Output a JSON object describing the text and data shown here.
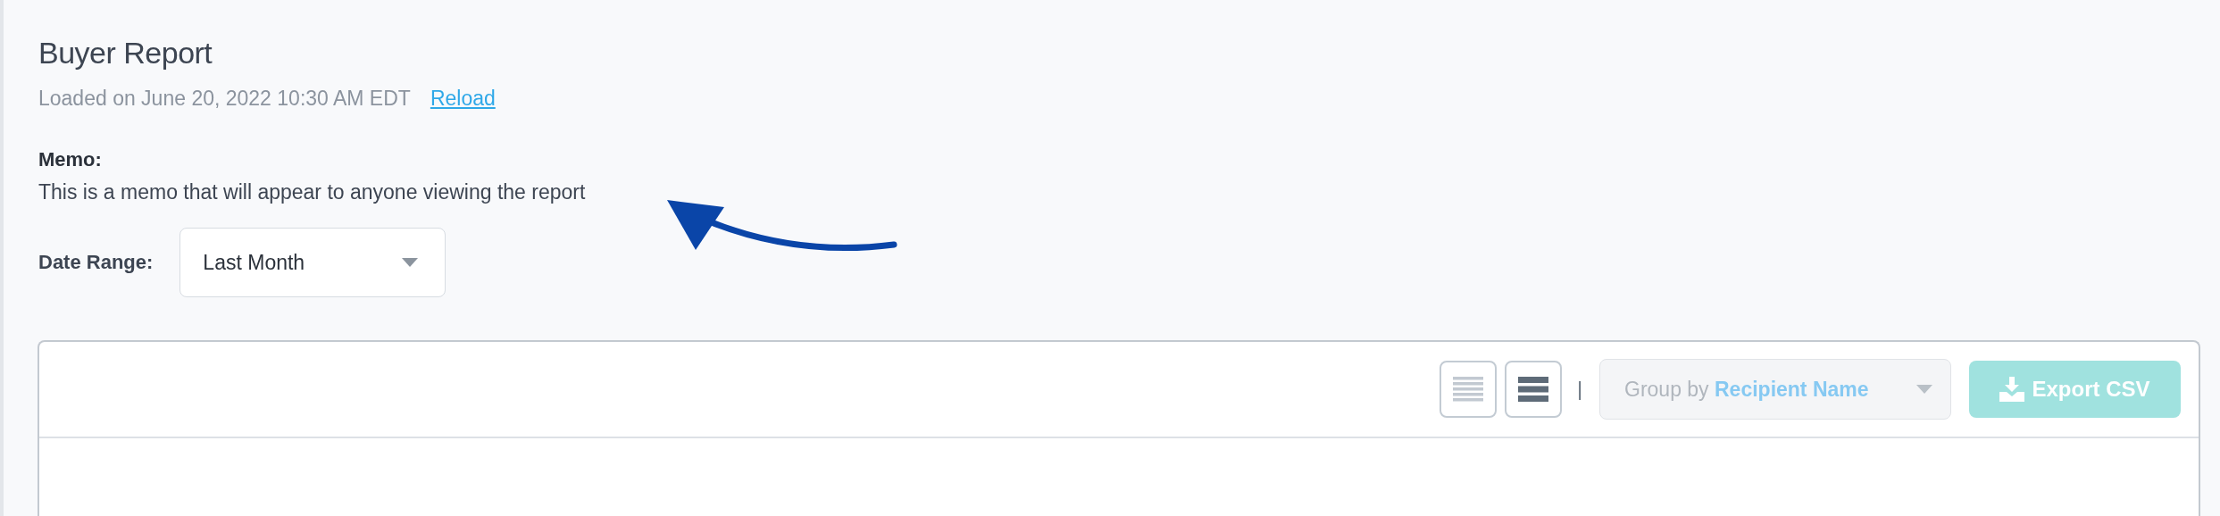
{
  "header": {
    "title": "Buyer Report",
    "loaded": "Loaded on June 20, 2022 10:30 AM EDT",
    "reload_link": "Reload"
  },
  "memo": {
    "label": "Memo:",
    "text": "This is a memo that will appear to anyone viewing the report"
  },
  "date_range": {
    "label": "Date Range:",
    "value": "Last Month"
  },
  "toolbar": {
    "view_buttons": [
      {
        "kind": "comfortable",
        "selected": false
      },
      {
        "kind": "compact",
        "selected": true
      }
    ],
    "separator": "|",
    "group_by": {
      "text": "Group by **Recipient Name**",
      "disabled": true
    },
    "export_button": {
      "label": "Export CSV",
      "disabled": true
    }
  }
}
